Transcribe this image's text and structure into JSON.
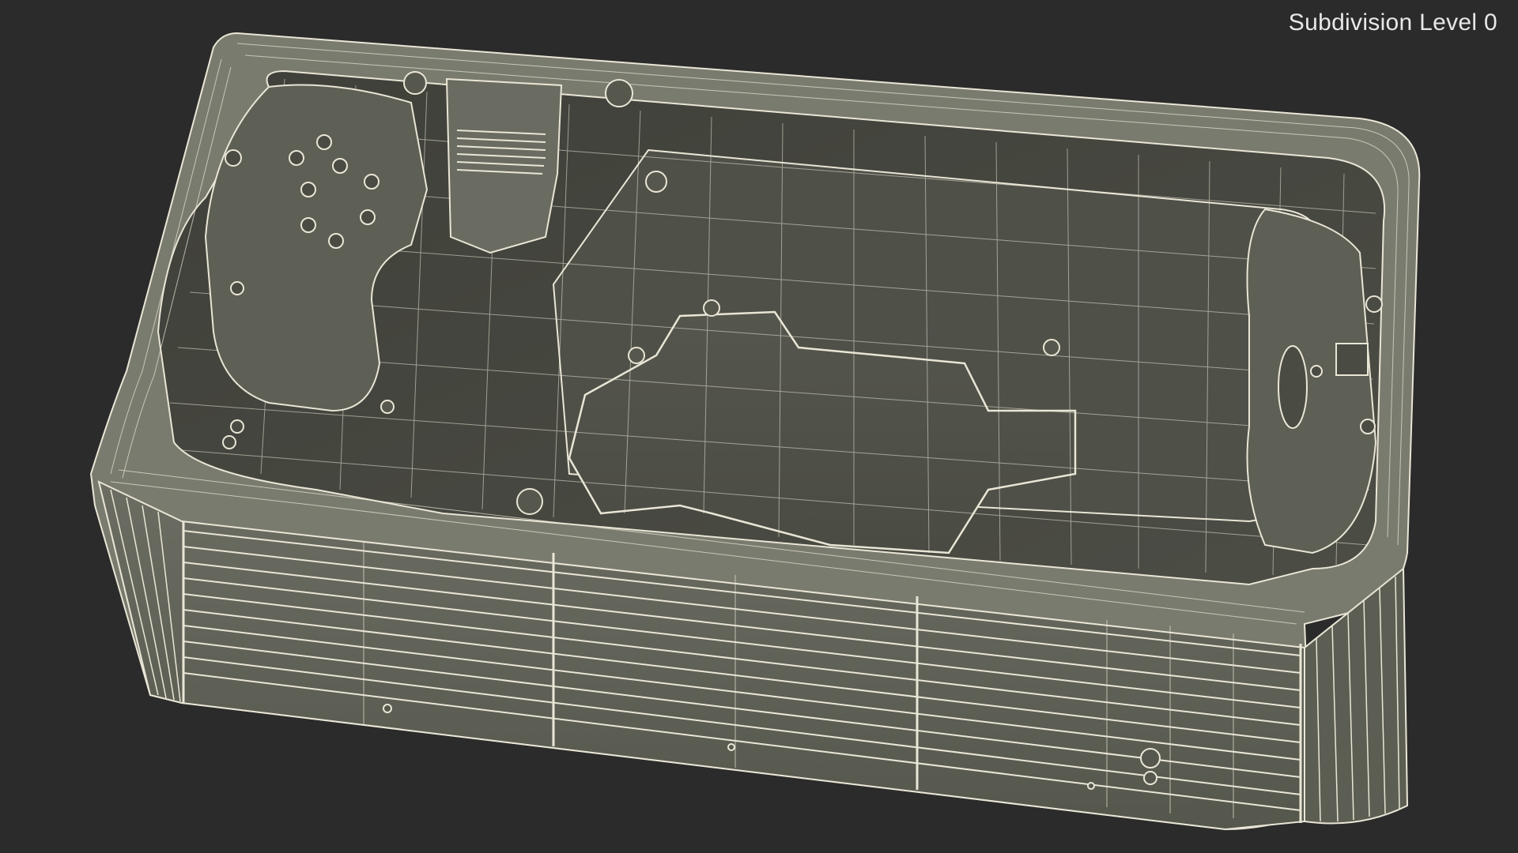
{
  "overlay": {
    "label": "Subdivision Level 0"
  },
  "scene": {
    "subject": "hot tub wireframe mesh",
    "background_color": "#2b2b2b",
    "surface_color": "#77786b",
    "wire_color": "#e9e6d6"
  }
}
